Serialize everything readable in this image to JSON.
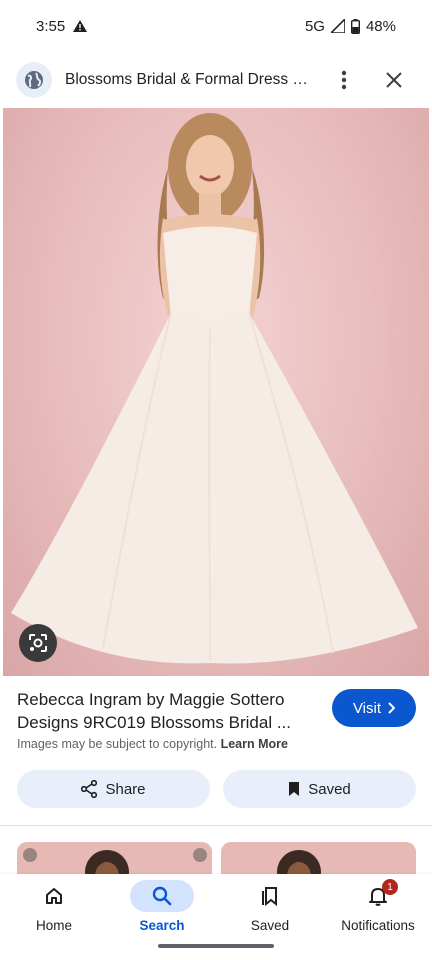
{
  "status_bar": {
    "time": "3:55",
    "network": "5G",
    "battery": "48%"
  },
  "header": {
    "site_title": "Blossoms Bridal & Formal Dress St..."
  },
  "image": {
    "alt_icon": "person-in-wedding-dress-image"
  },
  "caption": {
    "title": "Rebecca Ingram by Maggie Sottero Designs 9RC019 Blossoms Bridal ...",
    "visit_label": "Visit",
    "copyright_text": "Images may be subject to copyright.",
    "learn_more": "Learn More"
  },
  "actions": {
    "share_label": "Share",
    "saved_label": "Saved"
  },
  "bottom_nav": {
    "items": [
      {
        "label": "Home",
        "icon": "home-icon"
      },
      {
        "label": "Search",
        "icon": "search-icon",
        "active": true
      },
      {
        "label": "Saved",
        "icon": "saved-icon"
      },
      {
        "label": "Notifications",
        "icon": "bell-icon",
        "badge": "1"
      }
    ]
  },
  "colors": {
    "accent": "#0b57d0",
    "chip_bg": "#e8eefa",
    "badge": "#b3261e"
  }
}
